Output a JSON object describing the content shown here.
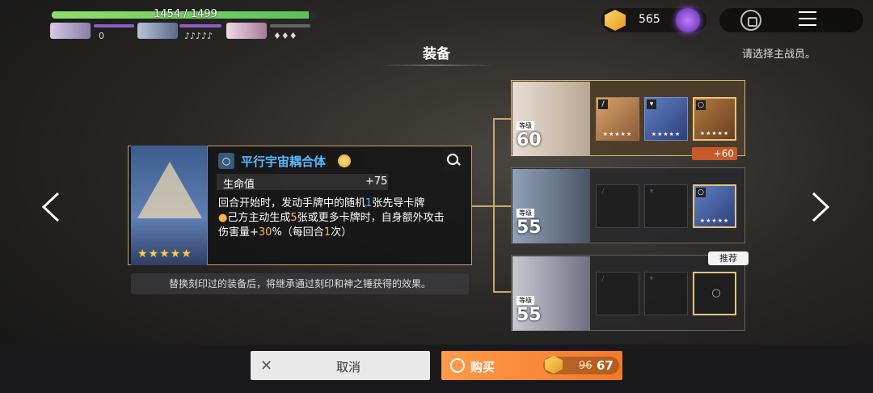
{
  "hud": {
    "hp_text": "1454 / 1499",
    "hp_fraction": 0.97,
    "party_counts": [
      "0",
      "♪♪♪♪♪",
      "♦♦♦"
    ]
  },
  "currency": {
    "amount": "565"
  },
  "screen": {
    "title": "装备",
    "hint": "请选择主战员。"
  },
  "item": {
    "name": "平行宇宙耦合体",
    "stars": "★★★★★",
    "stat_label": "生命值",
    "stat_value": "+75",
    "desc_line1_a": "回合开始时，发动手牌中的随机",
    "desc_line1_num": "1",
    "desc_line1_b": "张先导卡牌",
    "desc_line2_a": "己方主动生成",
    "desc_line2_num": "5",
    "desc_line2_b": "张或更多卡牌时，自身额外攻击",
    "desc_line3_a": "伤害量+",
    "desc_line3_num": "30",
    "desc_line3_b": "%（每回合",
    "desc_line3_num2": "1",
    "desc_line3_c": "次）",
    "footnote": "替换刻印过的装备后，将继承通过刻印和神之锤获得的效果。"
  },
  "characters": [
    {
      "level_tag": "等级",
      "level": "60",
      "bonus": "+60",
      "selected": true
    },
    {
      "level_tag": "等级",
      "level": "55",
      "selected": false
    },
    {
      "level_tag": "等级",
      "level": "55",
      "selected": false,
      "badge": "推荐"
    }
  ],
  "buttons": {
    "cancel": "取消",
    "buy": "购买",
    "price_old": "96",
    "price_new": "67"
  },
  "colors": {
    "accent_orange": "#f27a2a",
    "gold_border": "#c9a96c",
    "item_name_blue": "#5ab7ff"
  }
}
